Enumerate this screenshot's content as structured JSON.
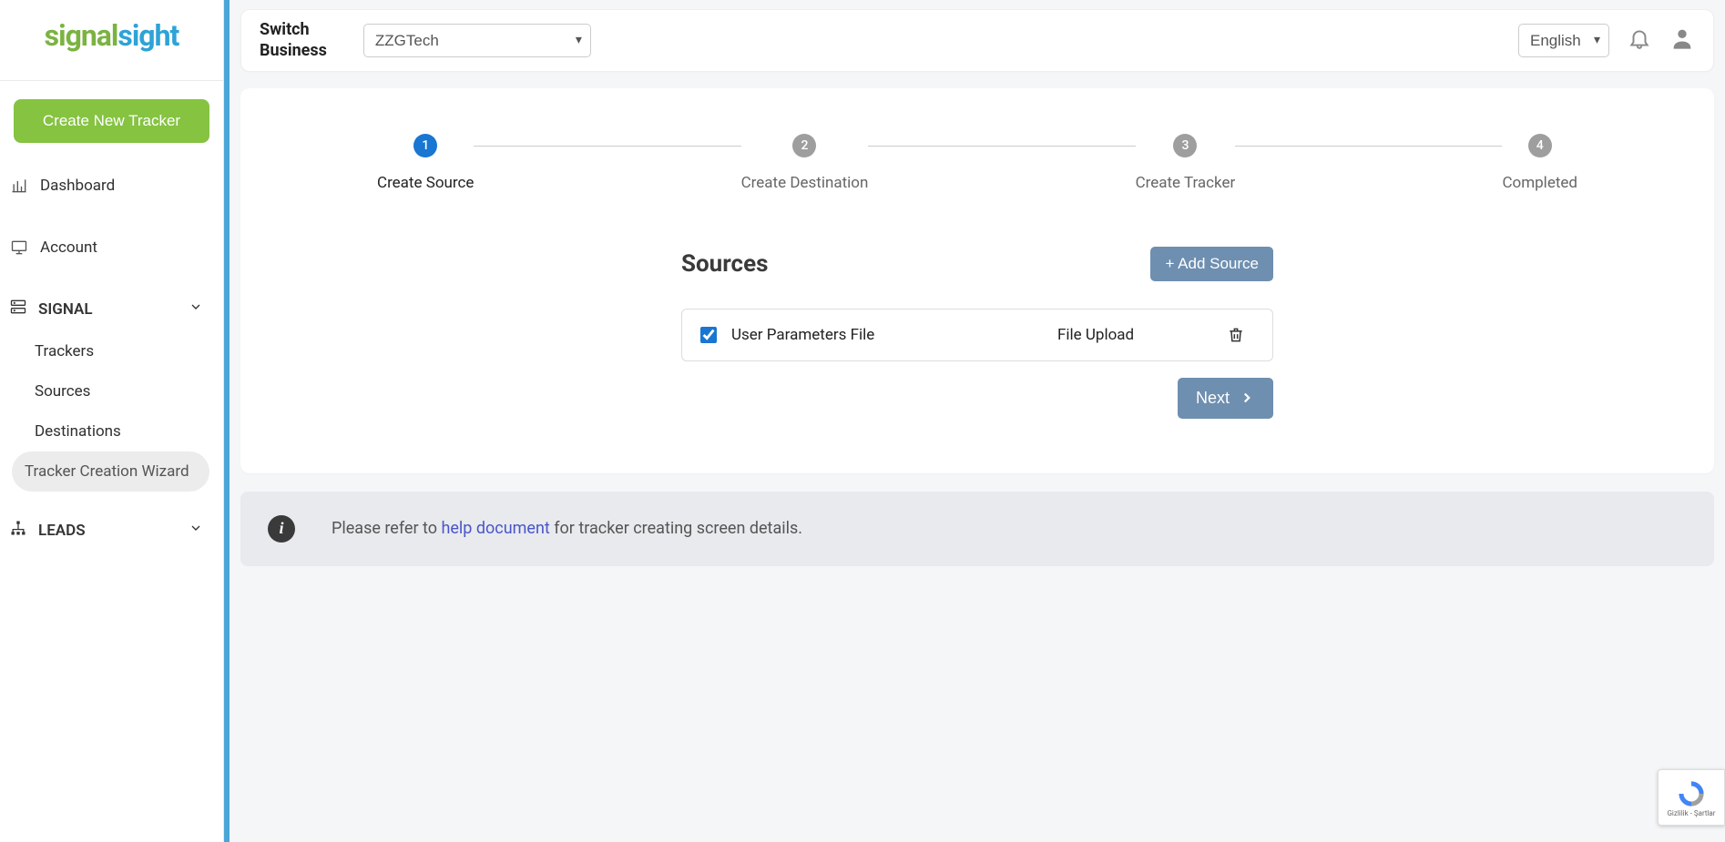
{
  "brand": {
    "s1": "signal",
    "s2": "sight"
  },
  "sidebar": {
    "create_btn": "Create New Tracker",
    "items": {
      "dashboard": "Dashboard",
      "account": "Account"
    },
    "signal": {
      "label": "SIGNAL",
      "trackers": "Trackers",
      "sources": "Sources",
      "destinations": "Destinations",
      "wizard": "Tracker Creation Wizard"
    },
    "leads": {
      "label": "LEADS"
    }
  },
  "topbar": {
    "switch_label_1": "Switch",
    "switch_label_2": "Business",
    "business_value": "ZZGTech",
    "lang_value": "English"
  },
  "stepper": {
    "s1": {
      "num": "1",
      "label": "Create Source"
    },
    "s2": {
      "num": "2",
      "label": "Create Destination"
    },
    "s3": {
      "num": "3",
      "label": "Create Tracker"
    },
    "s4": {
      "num": "4",
      "label": "Completed"
    }
  },
  "sources": {
    "title": "Sources",
    "add_btn": "+ Add Source",
    "row": {
      "name": "User Parameters File",
      "type": "File Upload"
    },
    "next_btn": "Next"
  },
  "info": {
    "pre": "Please refer to ",
    "link": "help document",
    "post": " for tracker creating screen details."
  },
  "recaptcha": {
    "label": "Gizlilik - Şartlar"
  }
}
